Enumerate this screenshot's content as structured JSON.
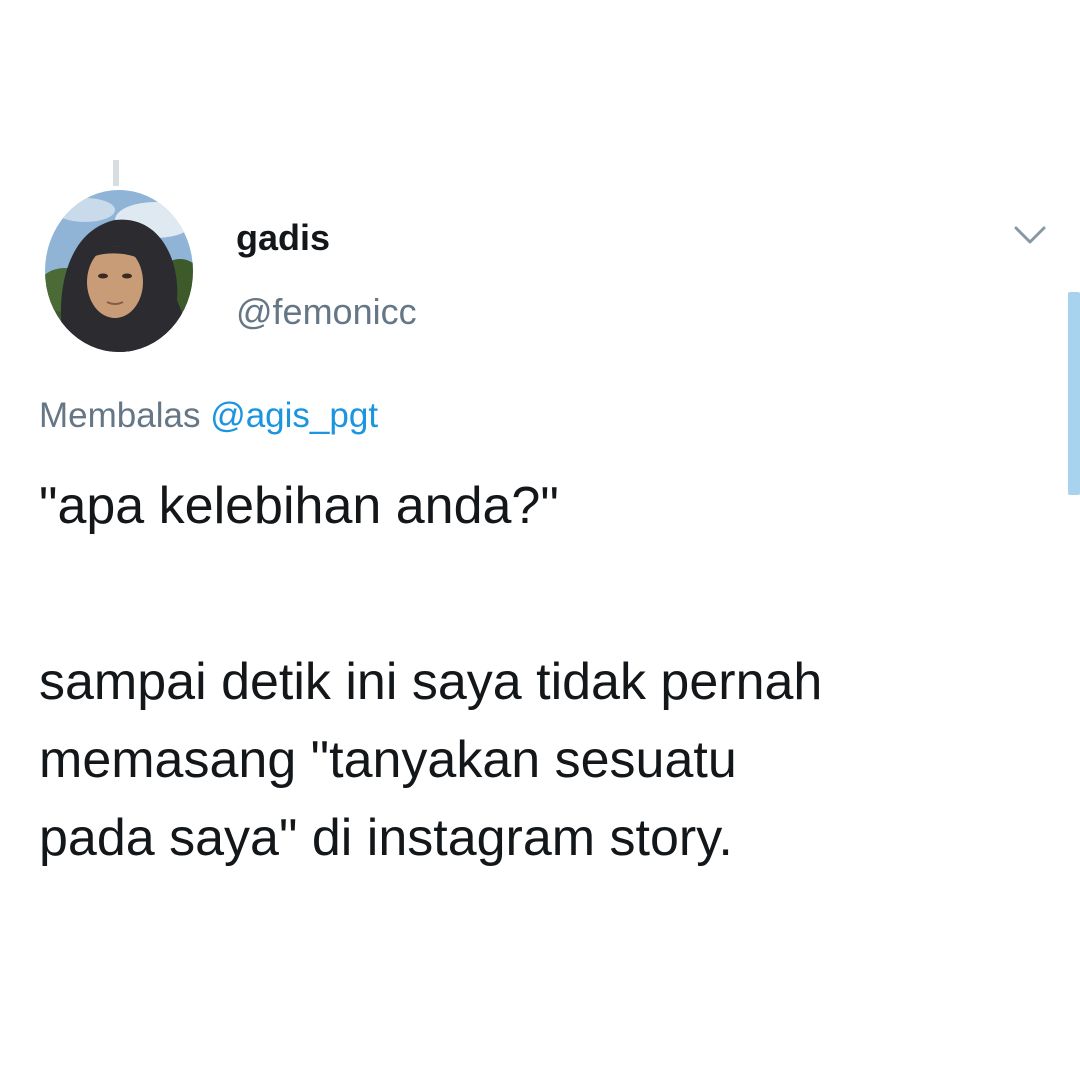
{
  "tweet": {
    "display_name": "gadis",
    "handle": "@femonicc",
    "reply_prefix": "Membalas",
    "reply_to": "@agis_pgt",
    "text_lines": [
      "\"apa kelebihan anda?\"",
      "sampai detik ini saya tidak pernah",
      "memasang \"tanyakan sesuatu",
      "pada saya\" di instagram story."
    ]
  },
  "icons": {
    "menu": "chevron-down-icon"
  },
  "colors": {
    "text": "#14171a",
    "secondary": "#657786",
    "link": "#1b95e0",
    "scroll_indicator": "#a7d3ef"
  }
}
